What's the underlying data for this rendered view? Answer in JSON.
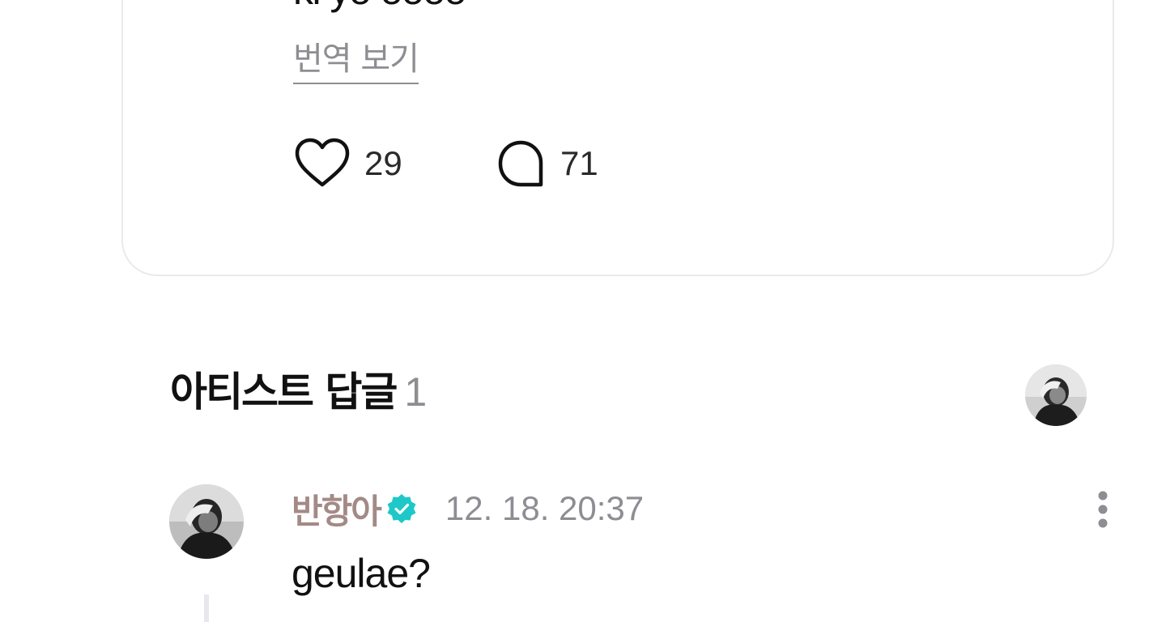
{
  "post": {
    "text": "ki yo oooo",
    "translate_label": "번역 보기",
    "likes": "29",
    "comments": "71"
  },
  "artist_replies": {
    "title": "아티스트 답글",
    "count": "1"
  },
  "reply": {
    "author": "반항아",
    "verified": true,
    "timestamp": "12. 18. 20:37",
    "text": "geulae?"
  },
  "colors": {
    "author_name": "#a38a86",
    "verified_badge": "#1ec8c8",
    "muted_text": "#8d8d93",
    "card_border": "#e9e9ee"
  },
  "icons": {
    "like": "heart-outline-icon",
    "comment": "speech-bubble-icon",
    "verified": "verified-check-icon",
    "more": "more-vertical-icon"
  }
}
